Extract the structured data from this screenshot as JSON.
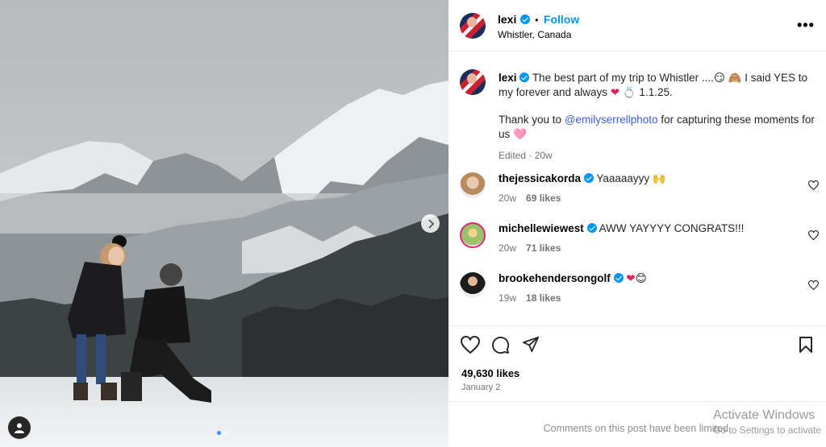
{
  "post": {
    "username": "lexi",
    "follow_label": "Follow",
    "separator": "•",
    "location": "Whistler, Canada",
    "more_label": "•••",
    "caption": {
      "line1": "The best part of my trip to Whistler ....😏 🙈 I said YES to my forever and always ",
      "line1_end": " 💍 1.1.25.",
      "line2_pre": "Thank you to ",
      "mention": "@emilyserrellphoto",
      "line2_post": " for capturing these moments for us 🩷",
      "edited": "Edited · 20w"
    },
    "comments": [
      {
        "username": "thejessicakorda",
        "text": "Yaaaaayyy 🙌",
        "age": "20w",
        "likes": "69 likes"
      },
      {
        "username": "michellewiewest",
        "text": "AWW YAYYYY CONGRATS!!!",
        "age": "20w",
        "likes": "71 likes"
      },
      {
        "username": "brookehendersongolf",
        "text": "😊",
        "age": "19w",
        "likes": "18 likes"
      }
    ],
    "like_count": "49,630 likes",
    "date": "January 2",
    "comments_limited": "Comments on this post have been limited."
  },
  "overlay": {
    "activate_title": "Activate Windows",
    "activate_sub": "Go to Settings to activate"
  },
  "colors": {
    "accent": "#0095f6",
    "mention": "#3b5ed6",
    "heart": "#e0245e"
  },
  "icons": [
    "verified-icon",
    "more-icon",
    "heart-icon",
    "comment-icon",
    "share-icon",
    "bookmark-icon",
    "chevron-right-icon",
    "user-tag-icon"
  ],
  "carousel": {
    "total": 2,
    "current": 1
  }
}
